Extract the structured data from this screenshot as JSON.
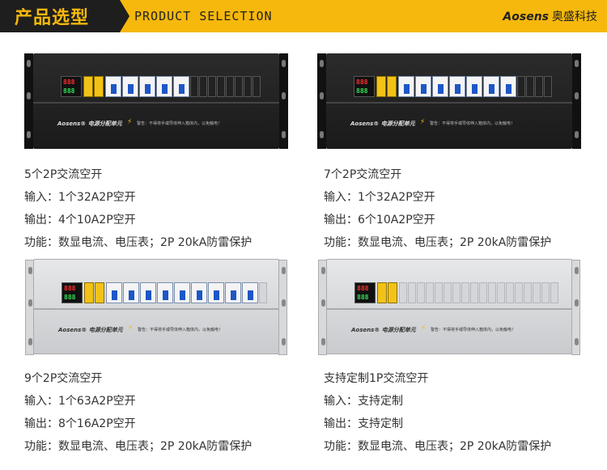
{
  "header": {
    "title_cn": "产品选型",
    "title_en": "PRODUCT SELECTION",
    "brand": "Aosens",
    "brand_cn": "奥盛科技"
  },
  "panel_text": {
    "logo": "Aosens® 电源分配单元",
    "warning": "警告：不得将手或导体伸入箱体内，以免触电！"
  },
  "products": [
    {
      "title": "5个2P交流空开",
      "input": "输入：1个32A2P空开",
      "output": "输出：4个10A2P空开",
      "function": "功能：数显电流、电压表；2P 20kA防雷保护",
      "breakers": 5,
      "finish": "black"
    },
    {
      "title": "7个2P交流空开",
      "input": "输入：1个32A2P空开",
      "output": "输出：6个10A2P空开",
      "function": "功能：数显电流、电压表；2P 20kA防雷保护",
      "breakers": 7,
      "finish": "black"
    },
    {
      "title": "9个2P交流空开",
      "input": "输入：1个63A2P空开",
      "output": "输出：8个16A2P空开",
      "function": "功能：数显电流、电压表；2P 20kA防雷保护",
      "breakers": 9,
      "finish": "silver"
    },
    {
      "title": "支持定制1P交流空开",
      "input": "输入：支持定制",
      "output": "输出：支持定制",
      "function": "功能：数显电流、电压表；2P 20kA防雷保护",
      "breakers": 0,
      "finish": "silver"
    }
  ]
}
